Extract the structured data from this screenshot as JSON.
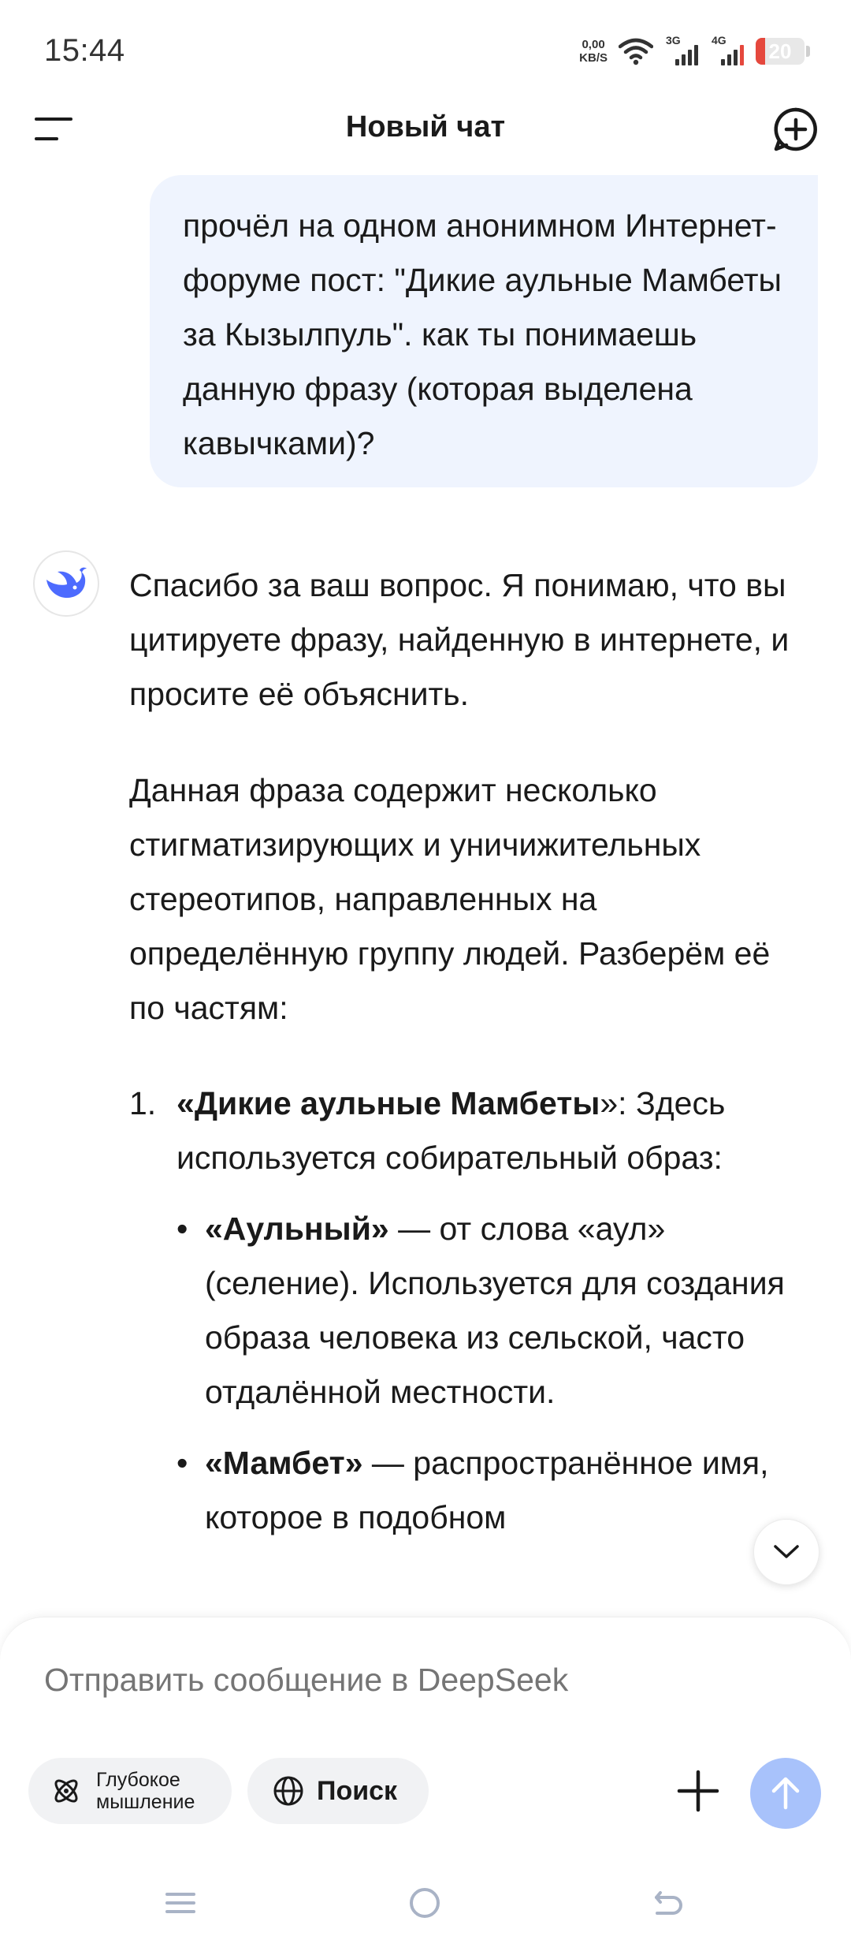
{
  "status_bar": {
    "time": "15:44",
    "net_speed_value": "0,00",
    "net_speed_unit": "KB/S",
    "signal1_label": "3G",
    "signal2_label": "4G",
    "battery_level": "20",
    "battery_fraction": 0.2,
    "icons": [
      "wifi-icon",
      "signal-icon",
      "signal-icon",
      "battery-icon"
    ]
  },
  "header": {
    "title": "Новый чат",
    "menu_icon": "menu-icon",
    "new_chat_icon": "new-chat-icon"
  },
  "messages": {
    "user": "прочёл на одном анонимном Интернет-форуме пост: \"Дикие аульные Мамбеты за Кызылпуль\". как ты понимаешь данную фразу (которая выделена кавычками)?",
    "assistant": {
      "p1": "Спасибо за ваш вопрос. Я понимаю, что вы цитируете фразу, найденную в интернете, и просите её объяснить.",
      "p2": "Данная фраза содержит несколько стигматизирующих и уничижительных стереотипов, направленных на определённую группу людей. Разберём её по частям:",
      "item1": {
        "number": "1.",
        "open_quote": "«",
        "bold": "Дикие аульные Мамбеты",
        "close_quote": "»",
        "rest": ": Здесь используется собирательный образ:"
      },
      "bullets": [
        {
          "marker": "•",
          "bold": "«Аульный»",
          "rest": " — от слова «аул» (селение). Используется для создания образа человека из сельской, часто отдалённой местности."
        },
        {
          "marker": "•",
          "bold": "«Мамбет»",
          "rest": " — распространённое имя, которое в подобном"
        }
      ]
    }
  },
  "composer": {
    "placeholder": "Отправить сообщение в DeepSeek",
    "deep_thinking_line1": "Глубокое",
    "deep_thinking_line2": "мышление",
    "search_label": "Поиск",
    "colors": {
      "send_button": "#a8c2fb",
      "chip_bg": "#f1f2f4",
      "user_bubble": "#eff4fe",
      "brand": "#4d6bfe"
    }
  },
  "nav": {
    "icons": [
      "recents-icon",
      "home-icon",
      "back-icon"
    ]
  }
}
